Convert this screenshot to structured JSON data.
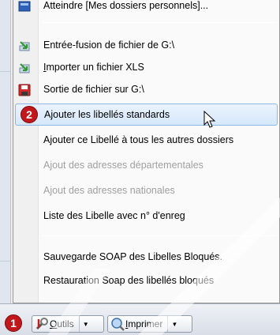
{
  "menu": {
    "items": [
      {
        "label": "Atteindre [Mes dossiers personnels]...",
        "icon": "folder-icon",
        "enabled": true
      },
      {
        "label": "Entrée-fusion de fichier de G:\\",
        "icon": "import-arrow-icon",
        "enabled": true
      },
      {
        "label": "Importer un fichier XLS",
        "icon": "import-arrow-icon",
        "enabled": true
      },
      {
        "label": "Sortie de fichier sur G:\\",
        "icon": "save-disk-icon",
        "enabled": true
      },
      {
        "label": "Ajouter les libellés standards",
        "icon": "",
        "enabled": true,
        "highlighted": true
      },
      {
        "label": "Ajouter ce Libellé à tous les autres dossiers",
        "icon": "",
        "enabled": true
      },
      {
        "label": "Ajout des adresses départementales",
        "icon": "",
        "enabled": false
      },
      {
        "label": "Ajout des adresses nationales",
        "icon": "",
        "enabled": false
      },
      {
        "label": "Liste des Libelle avec n° d'enreg",
        "icon": "",
        "enabled": true
      },
      {
        "label": "Sauvegarde SOAP des Libelles Bloqués.",
        "icon": "",
        "enabled": true
      },
      {
        "label": "Restauration Soap des libellés bloqués",
        "icon": "",
        "enabled": true
      }
    ]
  },
  "toolbar": {
    "outils_label": "Outils",
    "imprimer_label": "Imprimer"
  },
  "badges": {
    "step1": "1",
    "step2": "2"
  },
  "colors": {
    "badge": "#c0181b",
    "highlight_border": "#8fb5e3",
    "disabled_text": "#a0a0a0"
  }
}
